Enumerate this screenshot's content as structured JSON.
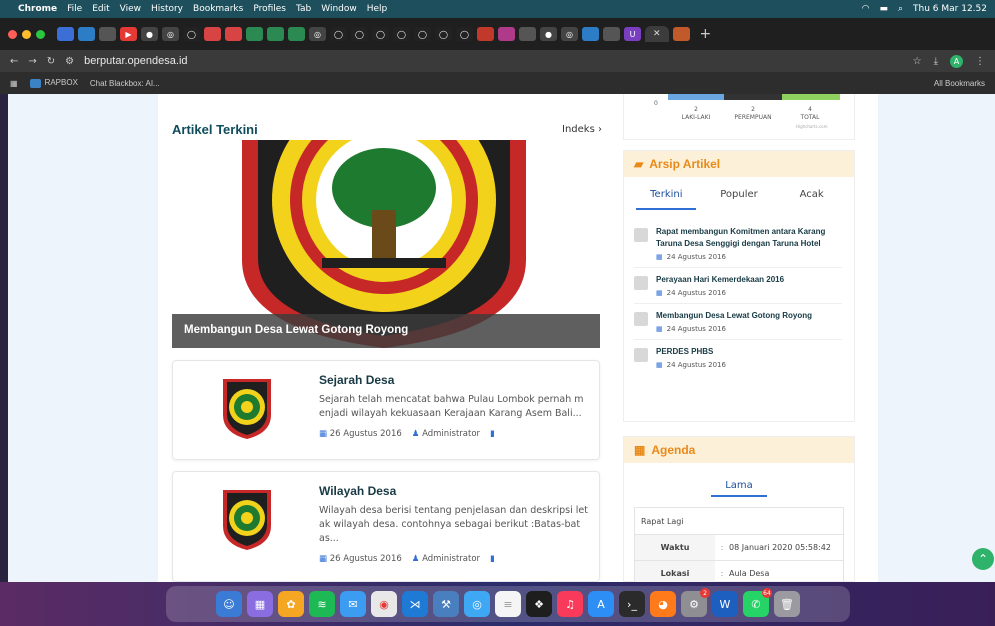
{
  "menubar": {
    "app": "Chrome",
    "items": [
      "File",
      "Edit",
      "View",
      "History",
      "Bookmarks",
      "Profiles",
      "Tab",
      "Window",
      "Help"
    ],
    "clock": "Thu 6 Mar  12.52"
  },
  "addressbar": {
    "url": "berputar.opendesa.id"
  },
  "bookmarks": {
    "items": [
      "RAPBOX",
      "Chat Blackbox: AI..."
    ],
    "all": "All Bookmarks"
  },
  "gender_chart": {
    "zero_label": "0",
    "bars": [
      {
        "value": "2",
        "label": "LAKI-LAKI",
        "color": "#6aa6e0"
      },
      {
        "value": "2",
        "label": "PEREMPUAN",
        "color": "#333333"
      },
      {
        "value": "4",
        "label": "TOTAL",
        "color": "#8fd15f"
      }
    ],
    "credit": "Highcharts.com"
  },
  "main": {
    "section_title": "Artikel Terkini",
    "index_link": "Indeks",
    "featured_title": "Membangun Desa Lewat Gotong Royong",
    "cards": [
      {
        "title": "Sejarah Desa",
        "excerpt": "Sejarah telah mencatat bahwa Pulau Lombok pernah m enjadi wilayah kekuasaan Kerajaan Karang Asem Bali...",
        "date": "26 Agustus 2016",
        "author": "Administrator"
      },
      {
        "title": "Wilayah Desa",
        "excerpt": "Wilayah desa berisi tentang penjelasan dan deskripsi let ak wilayah desa. contohnya sebagai berikut :Batas-bat as...",
        "date": "26 Agustus 2016",
        "author": "Administrator"
      }
    ]
  },
  "arsip": {
    "title": "Arsip Artikel",
    "tabs": [
      "Terkini",
      "Populer",
      "Acak"
    ],
    "articles": [
      {
        "title": "Rapat membangun Komitmen antara Karang Taruna Desa Senggigi dengan Taruna Hotel",
        "date": "24 Agustus 2016"
      },
      {
        "title": "Perayaan Hari Kemerdekaan 2016",
        "date": "24 Agustus 2016"
      },
      {
        "title": "Membangun Desa Lewat Gotong Royong",
        "date": "24 Agustus 2016"
      },
      {
        "title": "PERDES PHBS",
        "date": "24 Agustus 2016"
      }
    ]
  },
  "agenda": {
    "title": "Agenda",
    "tab": "Lama",
    "event": "Rapat Lagi",
    "rows": [
      {
        "key": "Waktu",
        "value": "08 Januari 2020 05:58:42"
      },
      {
        "key": "Lokasi",
        "value": "Aula Desa"
      }
    ]
  },
  "dock": {
    "badges": [
      "2",
      "64"
    ]
  },
  "colors": {
    "brand_teal": "#0f4d5c",
    "accent_orange": "#e88a1a",
    "link_blue": "#2f6fd6",
    "green": "#2fb36b"
  }
}
